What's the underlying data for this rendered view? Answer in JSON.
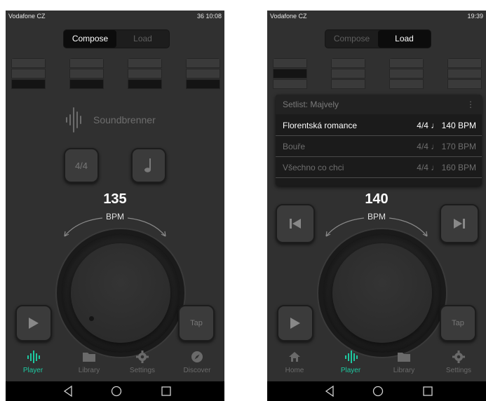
{
  "left": {
    "status": {
      "carrier": "Vodafone CZ",
      "right": "36 10:08"
    },
    "tabs": {
      "compose": "Compose",
      "load": "Load"
    },
    "logo_text": "Soundbrenner",
    "time_sig": "4/4",
    "note_icon": "quarter-note-icon",
    "bpm": {
      "value": "135",
      "label": "BPM"
    },
    "tap": "Tap",
    "nav": [
      {
        "label": "Player",
        "icon": "waveform-icon"
      },
      {
        "label": "Library",
        "icon": "folder-icon"
      },
      {
        "label": "Settings",
        "icon": "gear-icon"
      },
      {
        "label": "Discover",
        "icon": "compass-icon"
      }
    ]
  },
  "right": {
    "status": {
      "carrier": "Vodafone CZ",
      "right": "19:39"
    },
    "tabs": {
      "compose": "Compose",
      "load": "Load"
    },
    "setlist": {
      "title": "Setlist: Majvely",
      "menu": "⋮",
      "songs": [
        {
          "name": "Florentská romance",
          "meta": "4/4 ♩ 140 BPM"
        },
        {
          "name": "Bouře",
          "meta": "4/4 ♩ 170 BPM"
        },
        {
          "name": "Všechno co chci",
          "meta": "4/4 ♩ 160 BPM"
        }
      ]
    },
    "bpm": {
      "value": "140",
      "label": "BPM"
    },
    "tap": "Tap",
    "nav": [
      {
        "label": "Home",
        "icon": "home-icon"
      },
      {
        "label": "Player",
        "icon": "waveform-icon"
      },
      {
        "label": "Library",
        "icon": "folder-icon"
      },
      {
        "label": "Settings",
        "icon": "gear-icon"
      }
    ]
  },
  "colors": {
    "accent": "#1ec8a0",
    "bg": "#303030"
  }
}
